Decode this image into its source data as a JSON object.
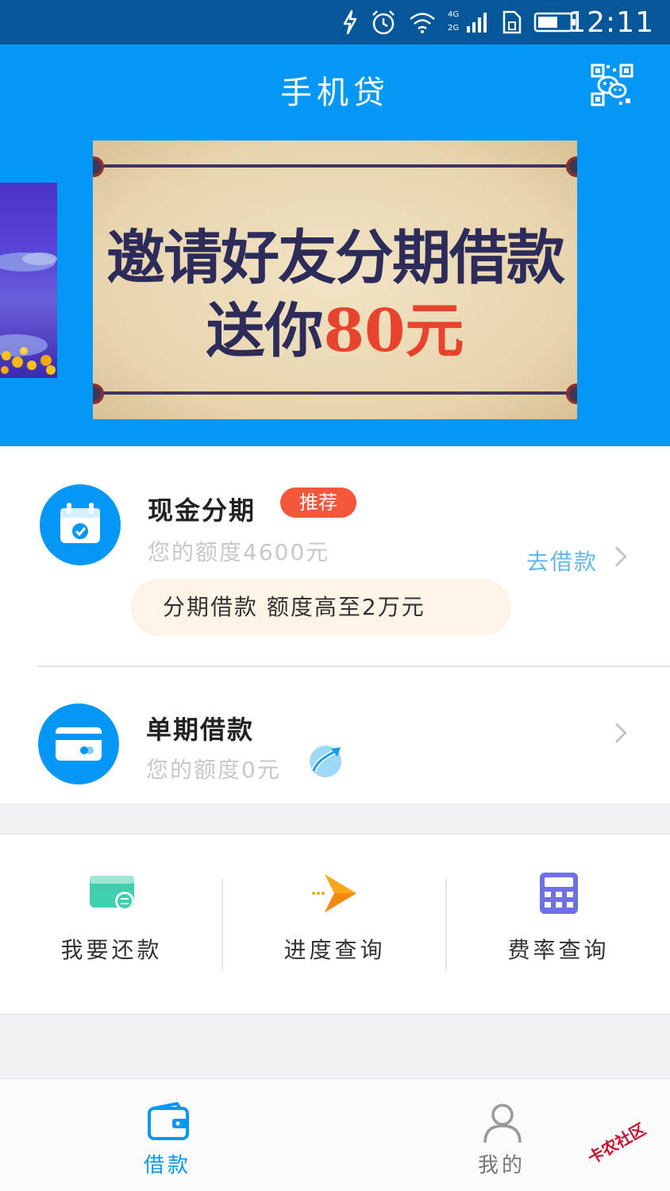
{
  "status_bar": {
    "network_label_top": "4G",
    "network_label_bottom": "2G",
    "time": "12:11",
    "icons": [
      "charging-icon",
      "alarm-icon",
      "wifi-icon",
      "signal-icon",
      "sim-icon",
      "battery-icon"
    ]
  },
  "header": {
    "title": "手机贷",
    "qr_icon": "wechat-qr-icon",
    "background_color": "#0597f5"
  },
  "banner": {
    "line1": "邀请好友分期借款",
    "line2_prefix": "送你",
    "line2_amount": "80元"
  },
  "products": [
    {
      "title": "现金分期",
      "badge": "推荐",
      "limit": "您的额度4600元",
      "action": "去借款",
      "promo": "分期借款 额度高至2万元",
      "icon": "calendar-check-icon"
    },
    {
      "title": "单期借款",
      "limit": "您的额度0元",
      "icon": "card-icon",
      "extra_icon": "trend-up-icon"
    }
  ],
  "quick_actions": [
    {
      "label": "我要还款",
      "icon": "repay-card-icon"
    },
    {
      "label": "进度查询",
      "icon": "paper-plane-icon"
    },
    {
      "label": "费率查询",
      "icon": "calculator-icon"
    }
  ],
  "bottom_nav": [
    {
      "label": "借款",
      "icon": "wallet-icon",
      "active": true
    },
    {
      "label": "我的",
      "icon": "user-icon",
      "active": false
    }
  ],
  "watermark": "卡农社区",
  "colors": {
    "primary": "#0597f5",
    "status_bar": "#06569a",
    "badge": "#f2573b",
    "link": "#66b7ee"
  }
}
